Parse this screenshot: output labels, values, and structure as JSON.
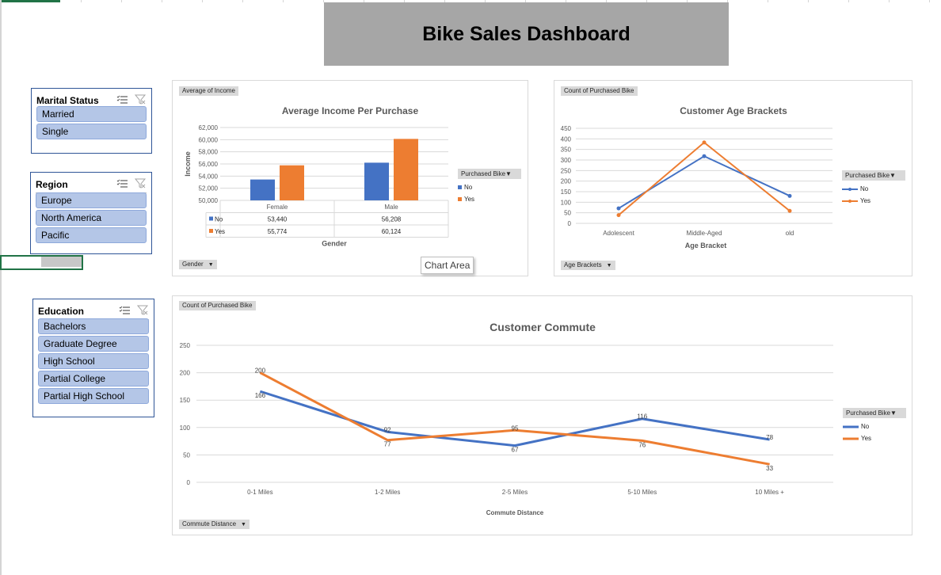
{
  "dashboard": {
    "title": "Bike Sales Dashboard"
  },
  "slicers": {
    "marital": {
      "title": "Marital Status",
      "items": [
        "Married",
        "Single"
      ]
    },
    "region": {
      "title": "Region",
      "items": [
        "Europe",
        "North America",
        "Pacific"
      ]
    },
    "education": {
      "title": "Education",
      "items": [
        "Bachelors",
        "Graduate Degree",
        "High School",
        "Partial College",
        "Partial High School"
      ]
    }
  },
  "tooltip": "Chart Area",
  "colors": {
    "no": "#4472c4",
    "yes": "#ed7d31",
    "banner": "#a6a6a6",
    "slicer_button": "#b4c6e7"
  },
  "chart_data": [
    {
      "type": "bar",
      "title": "Average Income Per Purchase",
      "value_field": "Average of Income",
      "axis_field": "Gender",
      "legend_title": "Purchased Bike",
      "xlabel": "Gender",
      "ylabel": "Income",
      "categories": [
        "Female",
        "Male"
      ],
      "series": [
        {
          "name": "No",
          "values": [
            53440,
            56208
          ],
          "labels": [
            "53,440",
            "56,208"
          ]
        },
        {
          "name": "Yes",
          "values": [
            55774,
            60124
          ],
          "labels": [
            "55,774",
            "60,124"
          ]
        }
      ],
      "ylim": [
        50000,
        62000
      ],
      "yticks": [
        "50,000",
        "52,000",
        "54,000",
        "56,000",
        "58,000",
        "60,000",
        "62,000"
      ],
      "legend_position": "right",
      "data_table": true,
      "grid": true
    },
    {
      "type": "line",
      "title": "Customer Age Brackets",
      "value_field": "Count of Purchased Bike",
      "axis_field": "Age Brackets",
      "legend_title": "Purchased Bike",
      "xlabel": "Age Bracket",
      "ylabel": "",
      "categories": [
        "Adolescent",
        "Middle-Aged",
        "old"
      ],
      "series": [
        {
          "name": "No",
          "values": [
            71,
            318,
            130
          ]
        },
        {
          "name": "Yes",
          "values": [
            39,
            383,
            59
          ]
        }
      ],
      "ylim": [
        0,
        450
      ],
      "yticks": [
        "0",
        "50",
        "100",
        "150",
        "200",
        "250",
        "300",
        "350",
        "400",
        "450"
      ],
      "legend_position": "right",
      "grid": true
    },
    {
      "type": "line",
      "title": "Customer Commute",
      "value_field": "Count of Purchased Bike",
      "axis_field": "Commute Distance",
      "legend_title": "Purchased Bike",
      "xlabel": "Commute Distance",
      "ylabel": "",
      "categories": [
        "0-1 Miles",
        "1-2 Miles",
        "2-5 Miles",
        "5-10 Miles",
        "10 Miles +"
      ],
      "series": [
        {
          "name": "No",
          "values": [
            166,
            92,
            67,
            116,
            78
          ]
        },
        {
          "name": "Yes",
          "values": [
            200,
            77,
            95,
            76,
            33
          ]
        }
      ],
      "ylim": [
        0,
        250
      ],
      "yticks": [
        "0",
        "50",
        "100",
        "150",
        "200",
        "250"
      ],
      "legend_position": "right",
      "data_labels": true,
      "grid": true
    }
  ]
}
